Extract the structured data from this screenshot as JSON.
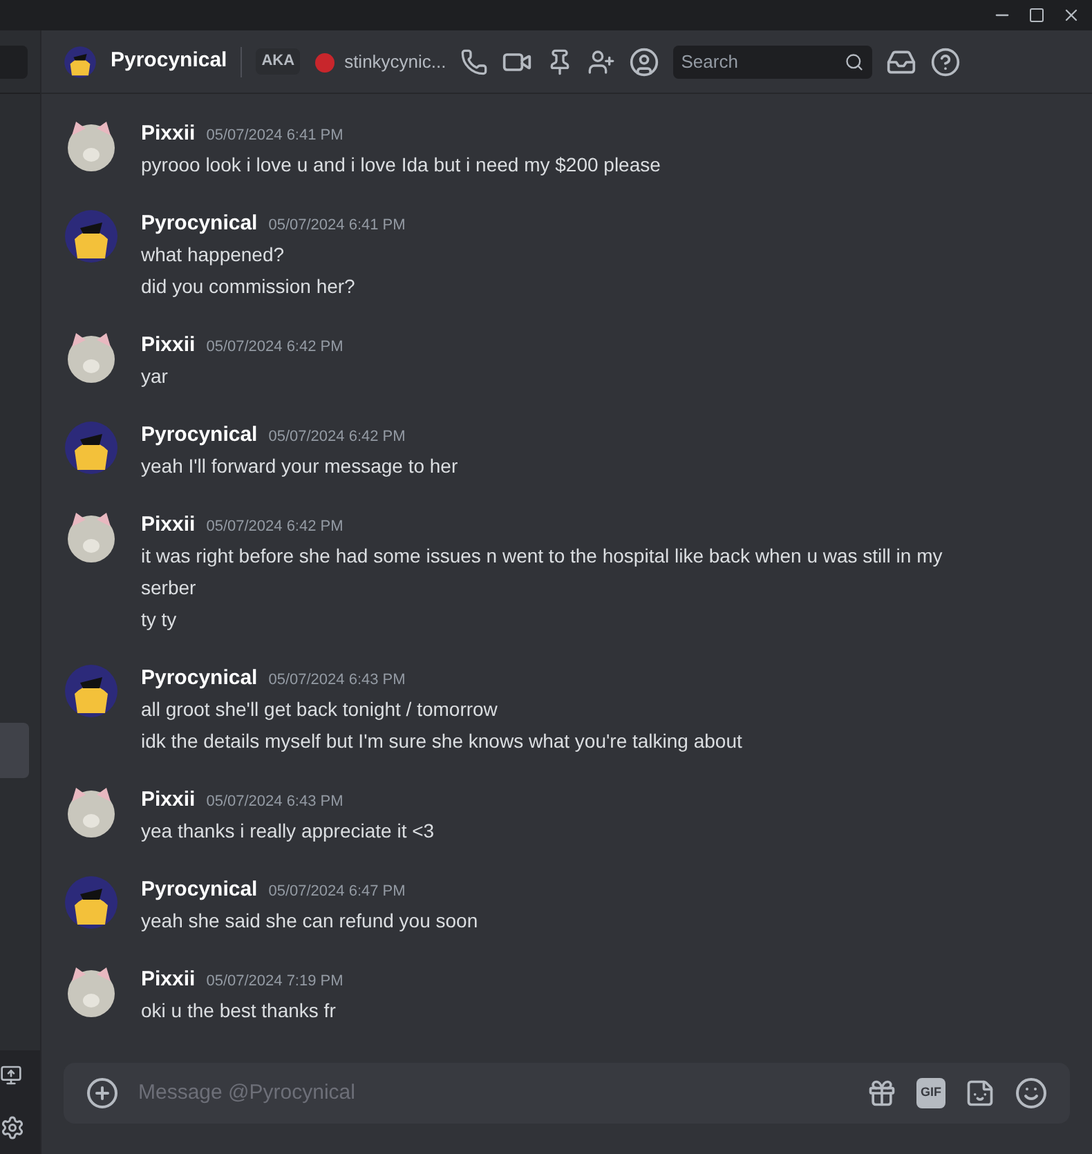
{
  "header": {
    "name": "Pyrocynical",
    "aka": "AKA",
    "alias": "stinkycynic...",
    "search": {
      "placeholder": "Search"
    }
  },
  "messages": [
    {
      "author": "Pixxii",
      "kind": "cat",
      "time": "05/07/2024 6:41 PM",
      "lines": [
        "pyrooo look i love u and i love Ida but i need my $200 please"
      ]
    },
    {
      "author": "Pyrocynical",
      "kind": "character",
      "time": "05/07/2024 6:41 PM",
      "lines": [
        "what happened?",
        "did you commission her?"
      ]
    },
    {
      "author": "Pixxii",
      "kind": "cat",
      "time": "05/07/2024 6:42 PM",
      "lines": [
        "yar"
      ]
    },
    {
      "author": "Pyrocynical",
      "kind": "character",
      "time": "05/07/2024 6:42 PM",
      "lines": [
        "yeah I'll forward your message to her"
      ]
    },
    {
      "author": "Pixxii",
      "kind": "cat",
      "time": "05/07/2024 6:42 PM",
      "lines": [
        "it was right before she had some issues n went to the hospital like back when u was still in my serber",
        "ty ty"
      ]
    },
    {
      "author": "Pyrocynical",
      "kind": "character",
      "time": "05/07/2024 6:43 PM",
      "lines": [
        "all groot she'll get back tonight / tomorrow",
        "idk the details myself but I'm sure she knows what you're talking about"
      ]
    },
    {
      "author": "Pixxii",
      "kind": "cat",
      "time": "05/07/2024 6:43 PM",
      "lines": [
        "yea thanks i really appreciate it <3"
      ]
    },
    {
      "author": "Pyrocynical",
      "kind": "character",
      "time": "05/07/2024 6:47 PM",
      "lines": [
        "yeah she said she can refund you soon"
      ]
    },
    {
      "author": "Pixxii",
      "kind": "cat",
      "time": "05/07/2024 7:19 PM",
      "lines": [
        "oki u the best thanks fr"
      ]
    }
  ],
  "composer": {
    "placeholder": "Message @Pyrocynical",
    "gif": "GIF"
  }
}
